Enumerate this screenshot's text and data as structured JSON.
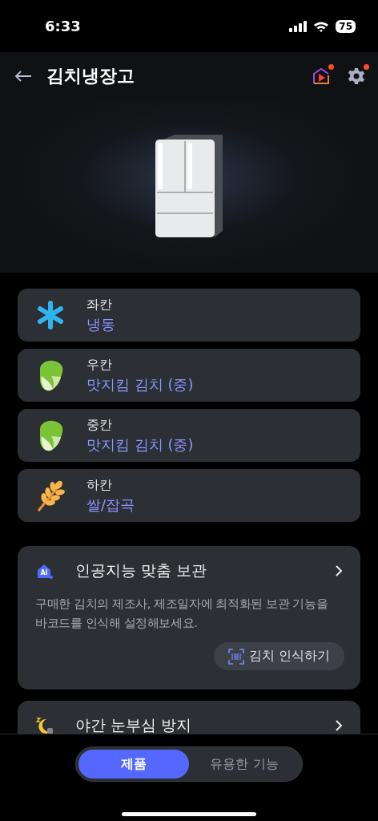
{
  "status_bar": {
    "time": "6:33",
    "battery": "75"
  },
  "header": {
    "title": "김치냉장고",
    "actions": [
      {
        "kind": "media",
        "notification": true
      },
      {
        "kind": "settings",
        "notification": true
      }
    ]
  },
  "compartments": [
    {
      "kind": "freeze",
      "name": "좌칸",
      "mode": "냉동"
    },
    {
      "kind": "kimchi",
      "name": "우칸",
      "mode": "맛지킴 김치 (중)"
    },
    {
      "kind": "kimchi",
      "name": "중칸",
      "mode": "맛지킴 김치 (중)"
    },
    {
      "kind": "grain",
      "name": "하칸",
      "mode": "쌀/잡곡"
    }
  ],
  "features": [
    {
      "kind": "ai",
      "icon_text": "AI",
      "title": "인공지능 맞춤 보관",
      "description": "구매한 김치의 제조사, 제조일자에 최적화된 보관 기능을 바코드를 인식해 설정해보세요.",
      "button": "김치 인식하기"
    },
    {
      "kind": "night",
      "title": "야간 눈부심 방지"
    }
  ],
  "tabs": [
    {
      "label": "제품",
      "selected": true
    },
    {
      "label": "유용한 기능",
      "selected": false
    }
  ]
}
